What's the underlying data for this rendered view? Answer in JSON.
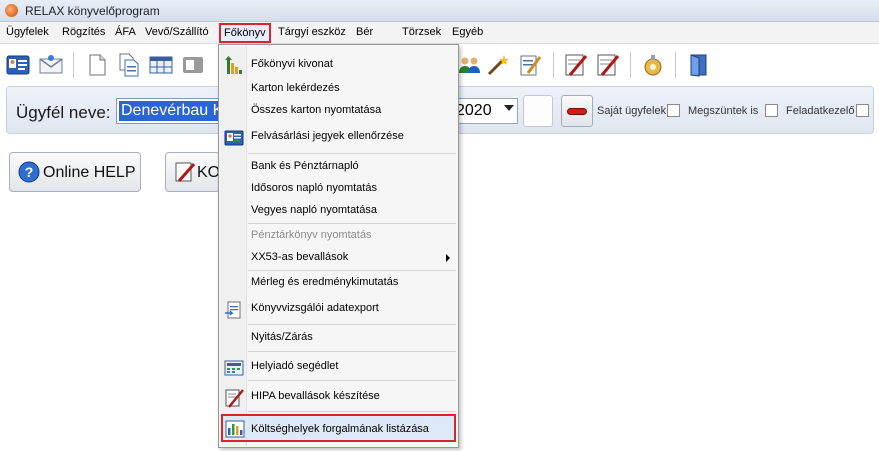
{
  "window": {
    "title": "RELAX könyvelőprogram"
  },
  "menubar": {
    "items": [
      "Ügyfelek",
      "Rögzítés",
      "ÁFA",
      "Vevő/Szállító",
      "Főkönyv",
      "Tárgyi eszköz",
      "Bér",
      "Törzsek",
      "Egyéb"
    ],
    "active": "Főkönyv"
  },
  "client": {
    "label": "Ügyfél neve:",
    "name": "Denevérbau K",
    "year": "2020"
  },
  "filters": {
    "own_clients": "Saját ügyfelek",
    "terminated": "Megszüntek is",
    "task_handler": "Feladatkezelő"
  },
  "buttons": {
    "online_help": "Online HELP",
    "second": "KO"
  },
  "dropdown": {
    "items": [
      {
        "label": "Főkönyvi kivonat",
        "icon": "ledger-chart-icon"
      },
      {
        "label": "Karton lekérdezés",
        "icon": ""
      },
      {
        "label": "Összes karton nyomtatása",
        "icon": ""
      },
      {
        "label": "Felvásárlási jegyek ellenőrzése",
        "icon": "id-card-icon"
      },
      {
        "label": "Bank és Pénztárnapló",
        "icon": ""
      },
      {
        "label": "Idősoros napló nyomtatás",
        "icon": ""
      },
      {
        "label": "Vegyes napló nyomtatása",
        "icon": ""
      },
      {
        "label": "Pénztárkönyv nyomtatás",
        "icon": "",
        "disabled": true
      },
      {
        "label": "XX53-as bevallások",
        "icon": "",
        "submenu": true
      },
      {
        "label": "Mérleg és eredménykimutatás",
        "icon": ""
      },
      {
        "label": "Könyvvizsgálói adatexport",
        "icon": "export-doc-icon"
      },
      {
        "label": "Nyitás/Zárás",
        "icon": ""
      },
      {
        "label": "Helyiadó segédlet",
        "icon": "calculator-icon"
      },
      {
        "label": "HIPA bevallások készítése",
        "icon": "sign-pen-icon"
      },
      {
        "label": "Költséghelyek forgalmának listázása",
        "icon": "bar-chart-icon",
        "highlighted": true
      }
    ]
  },
  "colors": {
    "highlight_border": "#d9262c",
    "selection": "#2a64d6"
  }
}
